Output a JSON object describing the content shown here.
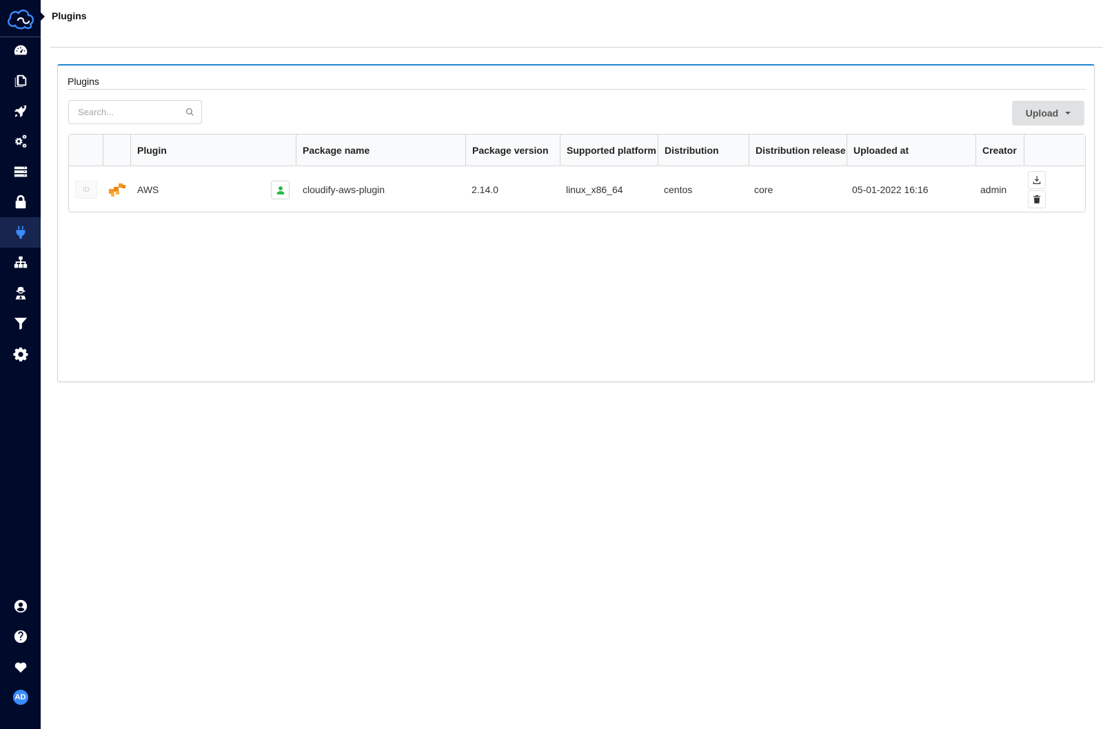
{
  "app": {
    "breadcrumb": "Plugins"
  },
  "sidebar": {
    "items": [
      {
        "name": "dashboard",
        "icon": "dashboard-icon"
      },
      {
        "name": "blueprints",
        "icon": "copy-icon"
      },
      {
        "name": "deployments",
        "icon": "rocket-icon"
      },
      {
        "name": "services",
        "icon": "cogs-icon"
      },
      {
        "name": "environments",
        "icon": "server-icon"
      },
      {
        "name": "secrets",
        "icon": "lock-icon"
      },
      {
        "name": "plugins",
        "icon": "plug-icon",
        "active": true
      },
      {
        "name": "sites",
        "icon": "sitemap-icon"
      },
      {
        "name": "agents",
        "icon": "user-secret-icon"
      },
      {
        "name": "filters",
        "icon": "filter-icon"
      },
      {
        "name": "settings",
        "icon": "gear-icon"
      }
    ],
    "bottom_items": [
      {
        "name": "profile",
        "icon": "user-circle-icon"
      },
      {
        "name": "help",
        "icon": "question-circle-icon"
      },
      {
        "name": "health",
        "icon": "heartbeat-icon"
      }
    ],
    "avatar_initials": "AD",
    "accent_color": "#3b8cff",
    "background_color": "#000a2b"
  },
  "widget": {
    "title": "Plugins",
    "search": {
      "placeholder": "Search...",
      "value": ""
    },
    "upload_label": "Upload",
    "columns": [
      "",
      "",
      "Plugin",
      "Package name",
      "Package version",
      "Supported platform",
      "Distribution",
      "Distribution release",
      "Uploaded at",
      "Creator",
      ""
    ],
    "rows": [
      {
        "id": "ID",
        "icon": "aws-icon",
        "plugin": "AWS",
        "visibility": "user-icon",
        "package_name": "cloudify-aws-plugin",
        "package_version": "2.14.0",
        "supported_platform": "linux_x86_64",
        "distribution": "centos",
        "distribution_release": "core",
        "uploaded_at": "05-01-2022 16:16",
        "creator": "admin"
      }
    ]
  }
}
